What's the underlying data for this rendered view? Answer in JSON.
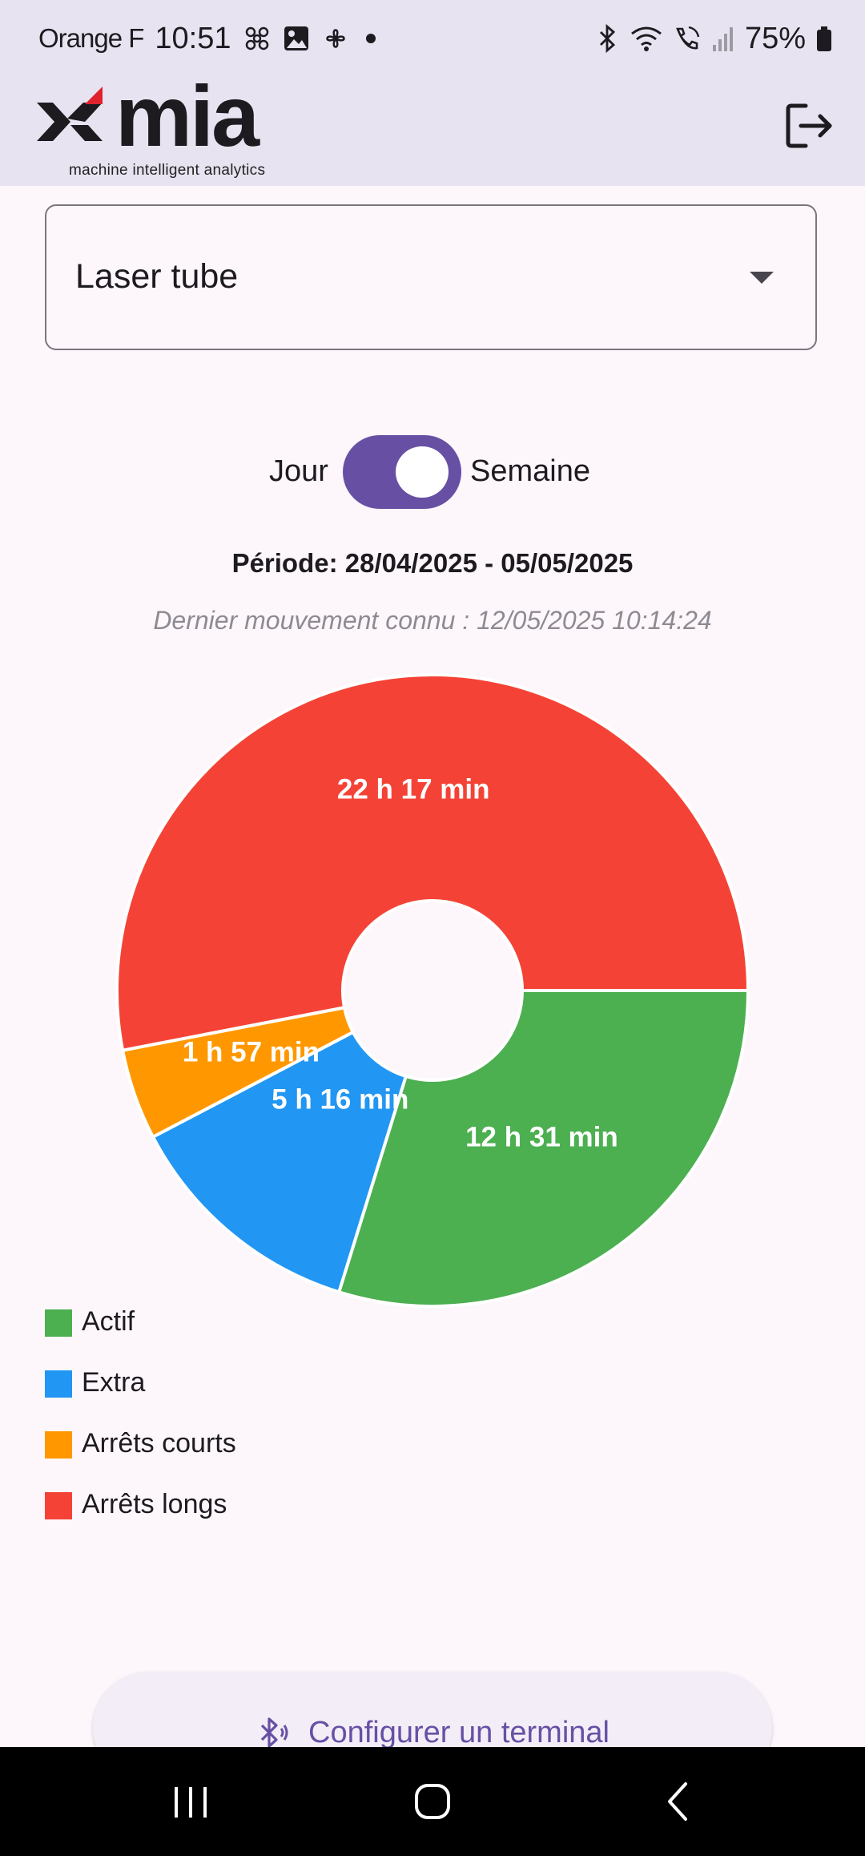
{
  "status_bar": {
    "carrier": "Orange F",
    "time": "10:51",
    "battery": "75%"
  },
  "app_bar": {
    "logo_text": "mia",
    "tagline": "machine intelligent analytics"
  },
  "machine_select": {
    "value": "Laser tube"
  },
  "period_toggle": {
    "left_label": "Jour",
    "right_label": "Semaine",
    "selected": "Semaine"
  },
  "period_text": "Période: 28/04/2025 - 05/05/2025",
  "last_movement": "Dernier mouvement connu : 12/05/2025 10:14:24",
  "chart_data": {
    "type": "pie",
    "donut": true,
    "categories": [
      "Actif",
      "Extra",
      "Arrêts courts",
      "Arrêts longs"
    ],
    "values_minutes": [
      751,
      316,
      117,
      1337
    ],
    "data_labels": [
      "12 h 31 min",
      "5 h 16 min",
      "1 h 57 min",
      "22 h 17 min"
    ],
    "colors": [
      "#4caf50",
      "#2196f3",
      "#ff9800",
      "#f44336"
    ],
    "legend_position": "bottom-left"
  },
  "legend": [
    {
      "label": "Actif",
      "color": "#4caf50"
    },
    {
      "label": "Extra",
      "color": "#2196f3"
    },
    {
      "label": "Arrêts courts",
      "color": "#ff9800"
    },
    {
      "label": "Arrêts longs",
      "color": "#f44336"
    }
  ],
  "config_button": {
    "label": "Configurer un terminal"
  },
  "colors": {
    "accent": "#6750a4",
    "header_bg": "#e8e3f0",
    "page_bg": "#fdf7fc"
  },
  "icons": {
    "logout": "logout-icon",
    "bluetooth": "bluetooth-icon",
    "dropdown": "caret-down-icon"
  }
}
